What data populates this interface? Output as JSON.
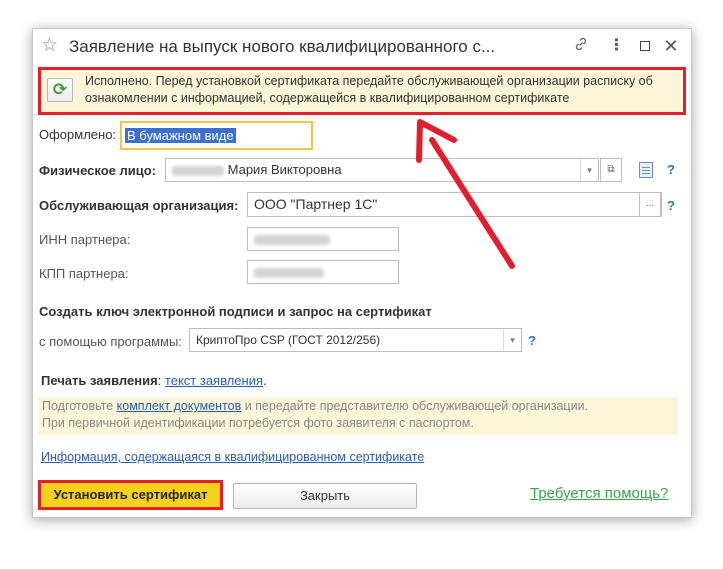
{
  "window": {
    "title": "Заявление на выпуск нового квалифицированного с...",
    "icons": [
      "star-icon",
      "link-icon",
      "menu-icon",
      "maximize-icon",
      "close-icon"
    ]
  },
  "notice": {
    "line1": "Исполнено. Перед установкой сертификата передайте обслуживающей организации расписку об",
    "line2": "ознакомлении с информацией, содержащейся в квалифицированном сертификате"
  },
  "form": {
    "issued_label": "Оформлено:",
    "issued_value": "В бумажном виде",
    "person_label": "Физическое лицо:",
    "person_value": "Мария Викторовна",
    "org_label": "Обслуживающая организация:",
    "org_value": "ООО \"Партнер 1С\"",
    "inn_label": "ИНН партнера:",
    "kpp_label": "КПП партнера:",
    "key_section_title": "Создать ключ электронной подписи и запрос на сертификат",
    "program_label": "с помощью программы:",
    "program_value": "КриптоПро CSP (ГОСТ 2012/256)",
    "print_label": "Печать заявления",
    "print_sep": ":",
    "print_link": "текст заявления",
    "print_end": ".",
    "help_mark": "?"
  },
  "hint": {
    "part1": "Подготовьте ",
    "link": "комплект документов",
    "part2": " и передайте представителю обслуживающей организации.",
    "line2": "При первичной идентификации потребуется фото заявителя с паспортом."
  },
  "cert_info_link": "Информация, содержащаяся в квалифицированном сертификате",
  "buttons": {
    "install": "Установить сертификат",
    "close": "Закрыть",
    "help": "Требуется помощь?"
  },
  "colors": {
    "highlight_border": "#e0202c",
    "primary_button": "#f7d21c",
    "notice_bg": "#fbf6d9",
    "link": "#2a5cb0",
    "help_link": "#3ca24a"
  }
}
